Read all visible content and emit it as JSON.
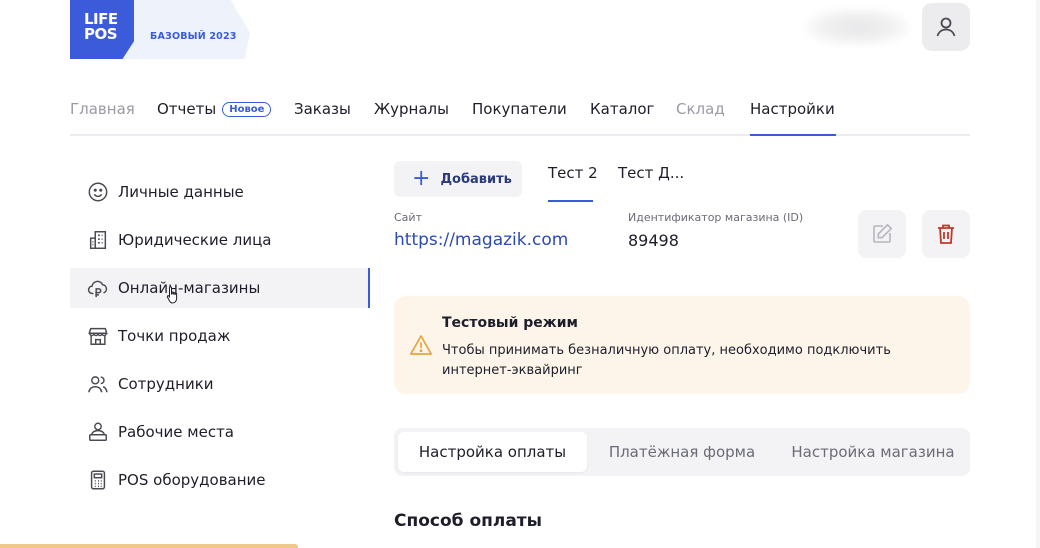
{
  "header": {
    "logo_line1": "LIFE",
    "logo_line2": "POS",
    "plan": "БАЗОВЫЙ 2023",
    "user_icon": "user-icon"
  },
  "nav": {
    "items": [
      {
        "label": "Главная"
      },
      {
        "label": "Отчеты",
        "badge": "Новое"
      },
      {
        "label": "Заказы"
      },
      {
        "label": "Журналы"
      },
      {
        "label": "Покупатели"
      },
      {
        "label": "Каталог"
      },
      {
        "label": "Склад"
      },
      {
        "label": "Настройки"
      }
    ],
    "active": "Настройки"
  },
  "sidebar": {
    "items": [
      {
        "label": "Личные данные",
        "icon": "smile-icon"
      },
      {
        "label": "Юридические лица",
        "icon": "building-icon"
      },
      {
        "label": "Онлайн-магазины",
        "icon": "cloud-ruble-icon"
      },
      {
        "label": "Точки продаж",
        "icon": "store-icon"
      },
      {
        "label": "Сотрудники",
        "icon": "users-icon"
      },
      {
        "label": "Рабочие места",
        "icon": "workplace-icon"
      },
      {
        "label": "POS оборудование",
        "icon": "calculator-icon"
      }
    ],
    "active": "Онлайн-магазины"
  },
  "shops": {
    "add_label": "Добавить",
    "tabs": [
      "Тест 2",
      "Тест Д..."
    ],
    "active_tab": "Тест 2"
  },
  "shop": {
    "site_label": "Сайт",
    "site_value": "https://magazik.com",
    "id_label": "Идентификатор магазина (ID)",
    "id_value": "89498"
  },
  "alert": {
    "title": "Тестовый режим",
    "text": "Чтобы принимать безналичную оплату, необходимо подключить интернет-эквайринг",
    "icon": "warning-icon"
  },
  "settings_tabs": {
    "items": [
      "Настройка оплаты",
      "Платёжная форма",
      "Настройка магазина"
    ],
    "active": "Настройка оплаты"
  },
  "section": {
    "title": "Способ оплаты"
  },
  "colors": {
    "accent": "#3b5bdb",
    "alert_bg": "#fdf5ea",
    "delete": "#c0392b"
  }
}
